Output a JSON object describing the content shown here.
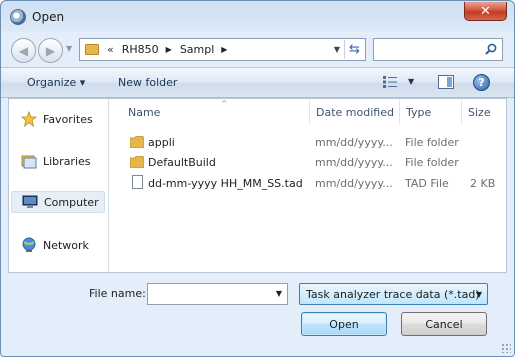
{
  "window": {
    "title": "Open",
    "close_label": "✕"
  },
  "address": {
    "history_chevron": "«",
    "crumbs": [
      "RH850",
      "Sampl"
    ],
    "search_placeholder": ""
  },
  "toolbar": {
    "organize_label": "Organize ▾",
    "new_folder_label": "New folder",
    "help_label": "?"
  },
  "nav": {
    "items": [
      {
        "label": "Favorites",
        "icon": "star-icon"
      },
      {
        "label": "Libraries",
        "icon": "libraries-icon"
      },
      {
        "label": "Computer",
        "icon": "computer-icon",
        "selected": true
      },
      {
        "label": "Network",
        "icon": "network-icon"
      }
    ]
  },
  "files": {
    "columns": [
      "Name",
      "Date modified",
      "Type",
      "Size"
    ],
    "sort_indicator": "^",
    "rows": [
      {
        "name": "appli",
        "date": "mm/dd/yyyy...",
        "type": "File folder",
        "size": "",
        "icon": "folder-icon"
      },
      {
        "name": "DefaultBuild",
        "date": "mm/dd/yyyy...",
        "type": "File folder",
        "size": "",
        "icon": "folder-icon"
      },
      {
        "name": "dd-mm-yyyy HH_MM_SS.tad",
        "date": "mm/dd/yyyy...",
        "type": "TAD File",
        "size": "2 KB",
        "icon": "file-icon"
      }
    ]
  },
  "bottom": {
    "file_name_label": "File name:",
    "file_name_value": "",
    "file_type_value": "Task analyzer trace data (*.tad)",
    "open_label": "Open",
    "cancel_label": "Cancel"
  },
  "colors": {
    "accent": "#3c7fb1",
    "folder": "#e6b84c",
    "close": "#c33b22"
  }
}
